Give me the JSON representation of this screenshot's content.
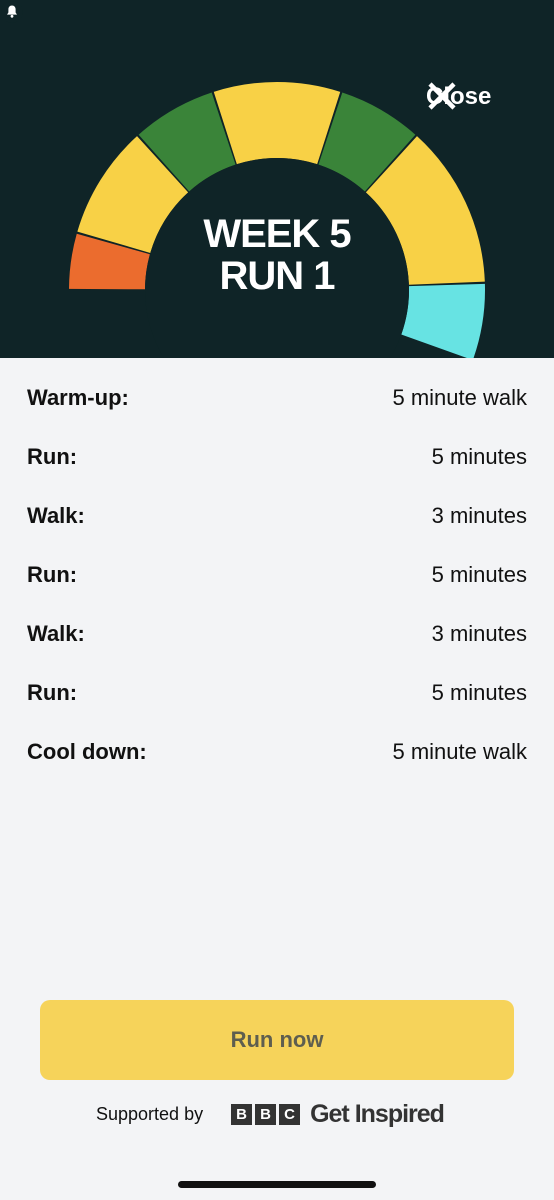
{
  "header": {
    "close_label": "Close",
    "title_line1": "WEEK 5",
    "title_line2": "RUN 1",
    "ring_colors": {
      "yellow": "#f8d146",
      "green": "#3a8439",
      "orange": "#eb6c2e",
      "cyan": "#67e3e3",
      "background": "#0f2427"
    }
  },
  "schedule": [
    {
      "label": "Warm-up:",
      "value": "5 minute walk"
    },
    {
      "label": "Run:",
      "value": "5 minutes"
    },
    {
      "label": "Walk:",
      "value": "3 minutes"
    },
    {
      "label": "Run:",
      "value": "5 minutes"
    },
    {
      "label": "Walk:",
      "value": "3 minutes"
    },
    {
      "label": "Run:",
      "value": "5 minutes"
    },
    {
      "label": "Cool down:",
      "value": "5 minute walk"
    }
  ],
  "actions": {
    "run_now_label": "Run now"
  },
  "footer": {
    "supported_by": "Supported by",
    "brand_letters": [
      "B",
      "B",
      "C"
    ],
    "brand_name": "Get Inspired"
  }
}
